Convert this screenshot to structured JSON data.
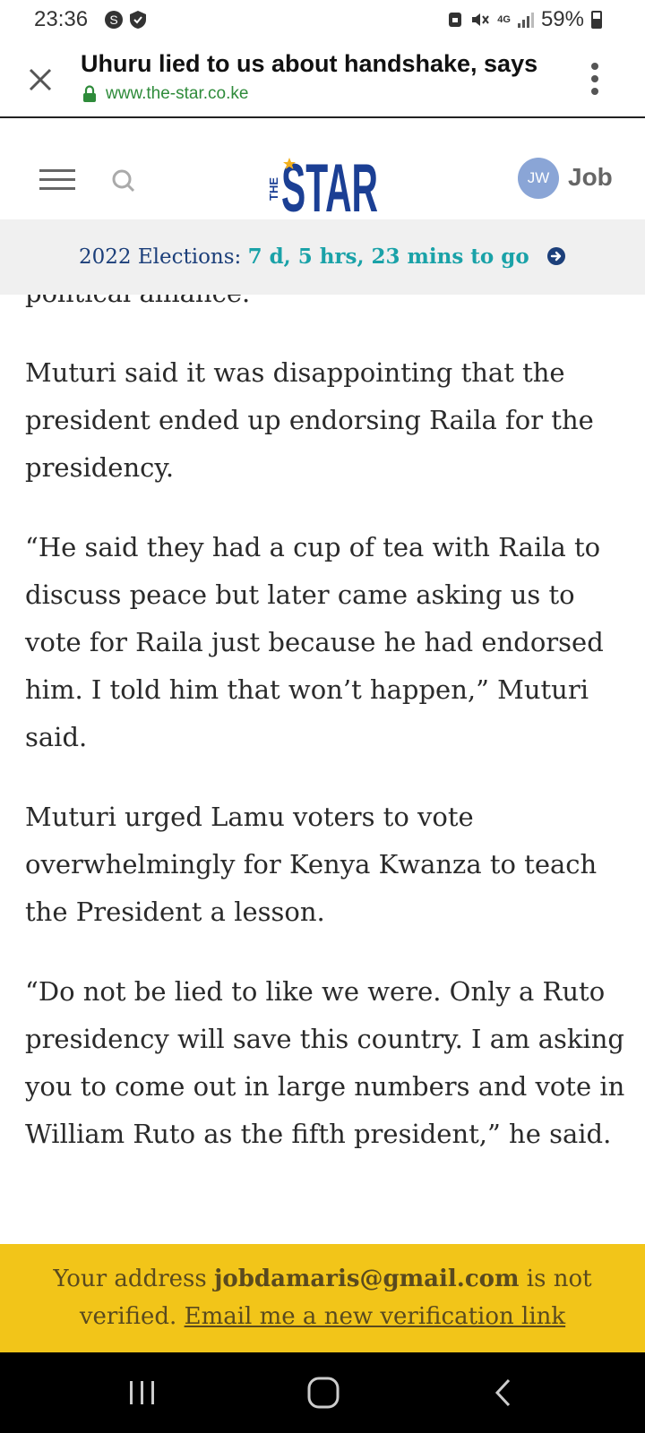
{
  "status_bar": {
    "time": "23:36",
    "battery": "59%",
    "network": "4G"
  },
  "browser": {
    "page_title": "Uhuru lied to us about handshake, says",
    "url": "www.the-star.co.ke"
  },
  "site_header": {
    "logo_small": "THE",
    "logo_main": "STAR",
    "avatar_initials": "JW",
    "user_name": "Job"
  },
  "countdown": {
    "label": "2022 Elections:",
    "time_left": "7 d, 5 hrs, 23 mins to go"
  },
  "article": {
    "paragraphs": [
      "political alliance.",
      "Muturi said it was disappointing that the president ended up endorsing Raila for the presidency.",
      "“He said they had a cup of tea with Raila to discuss peace but later came asking us to vote for Raila just because he had endorsed him. I told him that won’t happen,” Muturi said.",
      "Muturi urged Lamu voters to vote overwhelmingly for Kenya Kwanza to teach the President a lesson.",
      "“Do not be lied to like we were. Only a Ruto presidency will save this country. I am asking you to come out in large numbers and vote in William Ruto as the fifth president,” he said."
    ]
  },
  "verify_banner": {
    "text_before": "Your address ",
    "email": "jobdamaris@gmail.com",
    "text_after": " is not verified. ",
    "link_label": "Email me a new verification link"
  },
  "colors": {
    "banner_yellow": "#f2c519",
    "countdown_teal": "#1aa2a8",
    "logo_blue": "#1b3f94",
    "url_green": "#2e8b3a"
  }
}
